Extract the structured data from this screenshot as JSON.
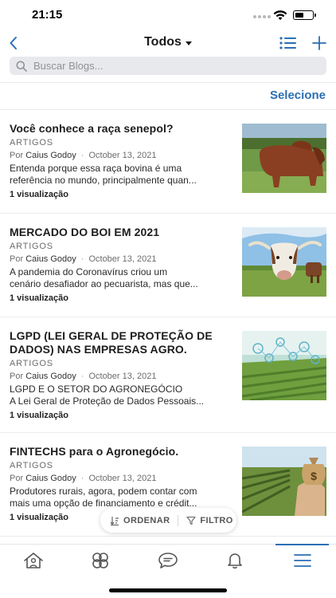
{
  "status_bar": {
    "time": "21:15"
  },
  "nav": {
    "title": "Todos"
  },
  "search": {
    "placeholder": "Buscar Blogs..."
  },
  "select_label": "Selecione",
  "posts": [
    {
      "title": "Você conhece a raça senepol?",
      "category": "ARTIGOS",
      "by": "Por",
      "author": "Caius Godoy",
      "date": "October 13, 2021",
      "excerpt_lines": [
        "Entenda porque essa raça bovina é uma",
        "referência no mundo, principalmente quan..."
      ],
      "views": "1 visualização"
    },
    {
      "title": "MERCADO DO BOI EM 2021",
      "category": "ARTIGOS",
      "by": "Por",
      "author": "Caius Godoy",
      "date": "October 13, 2021",
      "excerpt_lines": [
        "A pandemia do Coronavírus criou um",
        "cenário desafiador ao pecuarista, mas que..."
      ],
      "views": "1 visualização"
    },
    {
      "title_lines": [
        "LGPD (LEI GERAL DE PROTEÇÃO DE",
        "DADOS) NAS EMPRESAS AGRO."
      ],
      "category": "ARTIGOS",
      "by": "Por",
      "author": "Caius Godoy",
      "date": "October 13, 2021",
      "excerpt_lines": [
        "LGPD E O SETOR DO AGRONEGÓCIO",
        "A Lei Geral de Proteção de Dados Pessoais..."
      ],
      "views": "1 visualização"
    },
    {
      "title": "FINTECHS para o Agronegócio.",
      "category": "ARTIGOS",
      "by": "Por",
      "author": "Caius Godoy",
      "date": "October 13, 2021",
      "excerpt_lines": [
        "Produtores rurais, agora, podem contar com",
        "mais uma opção de financiamento e crédit..."
      ],
      "views": "1 visualização"
    }
  ],
  "sort_filter": {
    "sort_label": "ORDENAR",
    "filter_label": "FILTRO"
  },
  "tabs": [
    {
      "icon": "home-icon"
    },
    {
      "icon": "groups-icon"
    },
    {
      "icon": "chat-icon"
    },
    {
      "icon": "bell-icon"
    },
    {
      "icon": "menu-icon",
      "active": true
    }
  ],
  "colors": {
    "accent": "#2b6fb3",
    "search_bg": "#e8e9ec"
  }
}
